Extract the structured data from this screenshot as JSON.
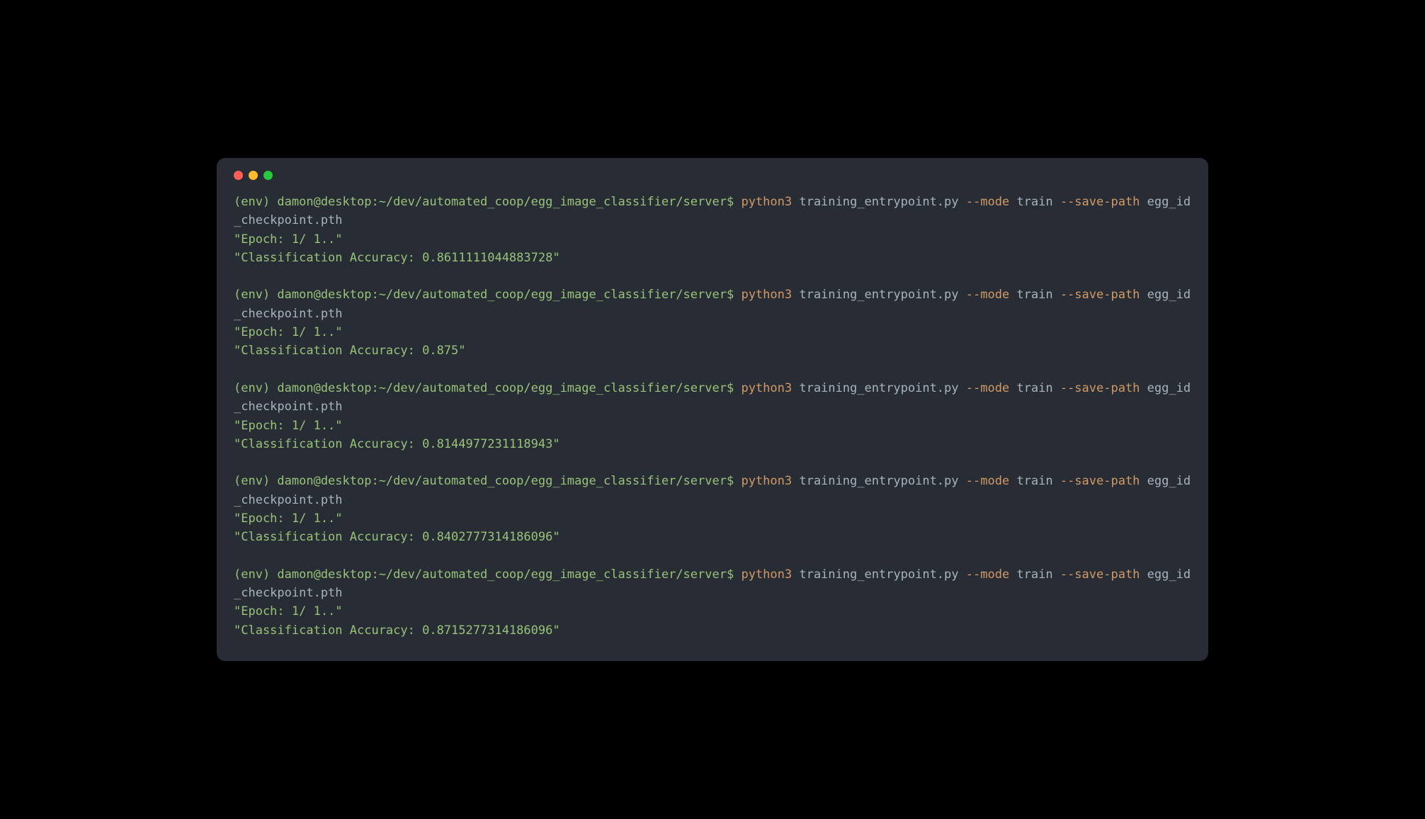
{
  "blocks": [
    {
      "prompt": "(env) damon@desktop:~/dev/automated_coop/egg_image_classifier/server$ ",
      "cmd": "python3 ",
      "script": "training_entrypoint.py ",
      "flag1": "--mode ",
      "arg1": "train ",
      "flag2": "--save-path ",
      "arg2": "egg_id_checkpoint.pth",
      "out1": "\"Epoch: 1/ 1..\"",
      "out2": "\"Classification Accuracy: 0.8611111044883728\""
    },
    {
      "prompt": "(env) damon@desktop:~/dev/automated_coop/egg_image_classifier/server$ ",
      "cmd": "python3 ",
      "script": "training_entrypoint.py ",
      "flag1": "--mode ",
      "arg1": "train ",
      "flag2": "--save-path ",
      "arg2": "egg_id_checkpoint.pth",
      "out1": "\"Epoch: 1/ 1..\"",
      "out2": "\"Classification Accuracy: 0.875\""
    },
    {
      "prompt": "(env) damon@desktop:~/dev/automated_coop/egg_image_classifier/server$ ",
      "cmd": "python3 ",
      "script": "training_entrypoint.py ",
      "flag1": "--mode ",
      "arg1": "train ",
      "flag2": "--save-path ",
      "arg2": "egg_id_checkpoint.pth",
      "out1": "\"Epoch: 1/ 1..\"",
      "out2": "\"Classification Accuracy: 0.8144977231118943\""
    },
    {
      "prompt": "(env) damon@desktop:~/dev/automated_coop/egg_image_classifier/server$ ",
      "cmd": "python3 ",
      "script": "training_entrypoint.py ",
      "flag1": "--mode ",
      "arg1": "train ",
      "flag2": "--save-path ",
      "arg2": "egg_id_checkpoint.pth",
      "out1": "\"Epoch: 1/ 1..\"",
      "out2": "\"Classification Accuracy: 0.8402777314186096\""
    },
    {
      "prompt": "(env) damon@desktop:~/dev/automated_coop/egg_image_classifier/server$ ",
      "cmd": "python3 ",
      "script": "training_entrypoint.py ",
      "flag1": "--mode ",
      "arg1": "train ",
      "flag2": "--save-path ",
      "arg2": "egg_id_checkpoint.pth",
      "out1": "\"Epoch: 1/ 1..\"",
      "out2": "\"Classification Accuracy: 0.8715277314186096\""
    }
  ]
}
